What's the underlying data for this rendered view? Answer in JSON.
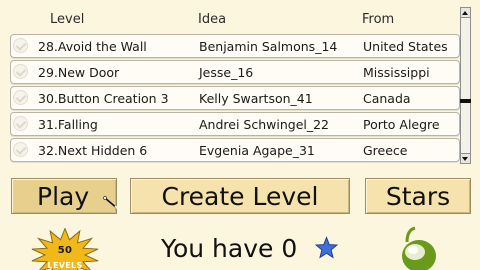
{
  "table": {
    "headers": [
      "Level",
      "Idea",
      "From"
    ],
    "rows": [
      {
        "level": "28.Avoid the Wall",
        "idea": "Benjamin Salmons_14",
        "from": "United States"
      },
      {
        "level": "29.New Door",
        "idea": "Jesse_16",
        "from": "Mississippi"
      },
      {
        "level": "30.Button Creation 3",
        "idea": "Kelly Swartson_41",
        "from": "Canada"
      },
      {
        "level": "31.Falling",
        "idea": "Andrei Schwingel_22",
        "from": "Porto Alegre"
      },
      {
        "level": "32.Next Hidden 6",
        "idea": "Evgenia Agape_31",
        "from": "Greece"
      }
    ],
    "scroll_position_fraction": 0.62
  },
  "buttons": {
    "play": "Play",
    "create_level": "Create Level",
    "stars": "Stars"
  },
  "badge": {
    "count": "50",
    "label": "LEVELS"
  },
  "stars_status": {
    "text": "You have 0",
    "count": 0
  },
  "icons": {
    "badge": "starburst-badge-icon",
    "star": "blue-star-icon",
    "drop": "green-drop-icon",
    "wand": "magic-wand-icon"
  },
  "colors": {
    "background": "#fdf6de",
    "button": "#f5e2ac",
    "play_button_selected": "#e7cf8e",
    "badge": "#f1b81a",
    "star": "#3f6fd8",
    "drop": "#6a9a1a"
  }
}
